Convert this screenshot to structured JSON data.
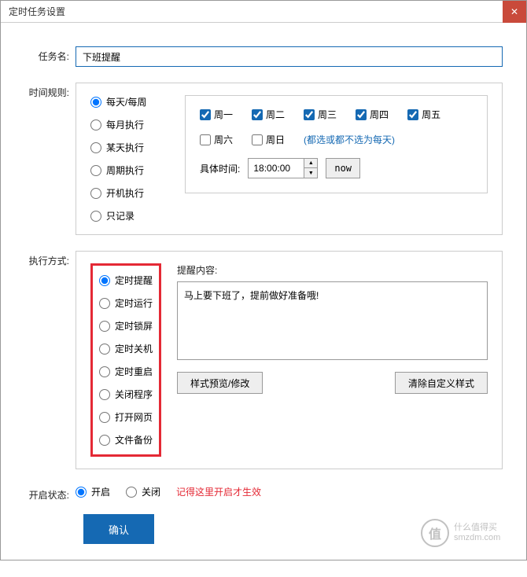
{
  "titlebar": {
    "title": "定时任务设置"
  },
  "taskName": {
    "label": "任务名:",
    "value": "下班提醒"
  },
  "timeRule": {
    "label": "时间规则:",
    "options": [
      "每天/每周",
      "每月执行",
      "某天执行",
      "周期执行",
      "开机执行",
      "只记录"
    ],
    "days": {
      "mon": "周一",
      "tue": "周二",
      "wed": "周三",
      "thu": "周四",
      "fri": "周五",
      "sat": "周六",
      "sun": "周日"
    },
    "hint": "(都选或都不选为每天)",
    "timeLabel": "具体时间:",
    "timeValue": "18:00:00",
    "nowLabel": "now"
  },
  "execMode": {
    "label": "执行方式:",
    "options": [
      "定时提醒",
      "定时运行",
      "定时锁屏",
      "定时关机",
      "定时重启",
      "关闭程序",
      "打开网页",
      "文件备份"
    ],
    "contentLabel": "提醒内容:",
    "contentValue": "马上要下班了，提前做好准备哦!",
    "previewBtn": "样式预览/修改",
    "clearBtn": "清除自定义样式"
  },
  "status": {
    "label": "开启状态:",
    "on": "开启",
    "off": "关闭",
    "hint": "记得这里开启才生效"
  },
  "submit": "确认",
  "watermark": {
    "char": "值",
    "line1": "什么值得买",
    "line2": "smzdm.com"
  }
}
